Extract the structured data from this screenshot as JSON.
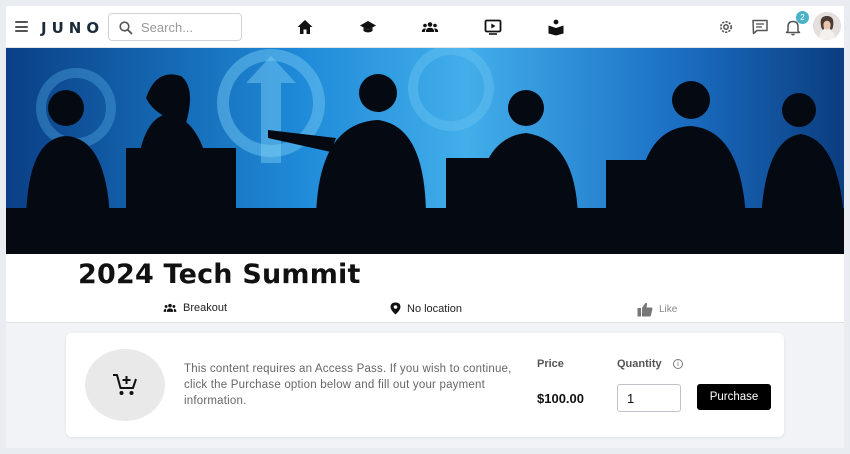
{
  "app": {
    "logo_text": "JUNO"
  },
  "search": {
    "placeholder": "Search..."
  },
  "nav": {
    "icons": [
      "home-icon",
      "graduation-cap-icon",
      "groups-icon",
      "video-icon",
      "book-reader-icon"
    ]
  },
  "header_right": {
    "notification_count": "2",
    "icons": [
      "settings-icon",
      "chat-icon",
      "bell-icon"
    ]
  },
  "event": {
    "title": "2024 Tech Summit",
    "type_label": "Breakout",
    "location_label": "No location",
    "like_label": "Like"
  },
  "purchase": {
    "message": "This content requires an Access Pass. If you wish to continue, click the Purchase option below and fill out your payment information.",
    "price_label": "Price",
    "price_value": "$100.00",
    "quantity_label": "Quantity",
    "quantity_value": "1",
    "button_label": "Purchase"
  },
  "colors": {
    "accent": "#4ab3c8",
    "button": "#000000",
    "banner": "#1a75c9"
  }
}
